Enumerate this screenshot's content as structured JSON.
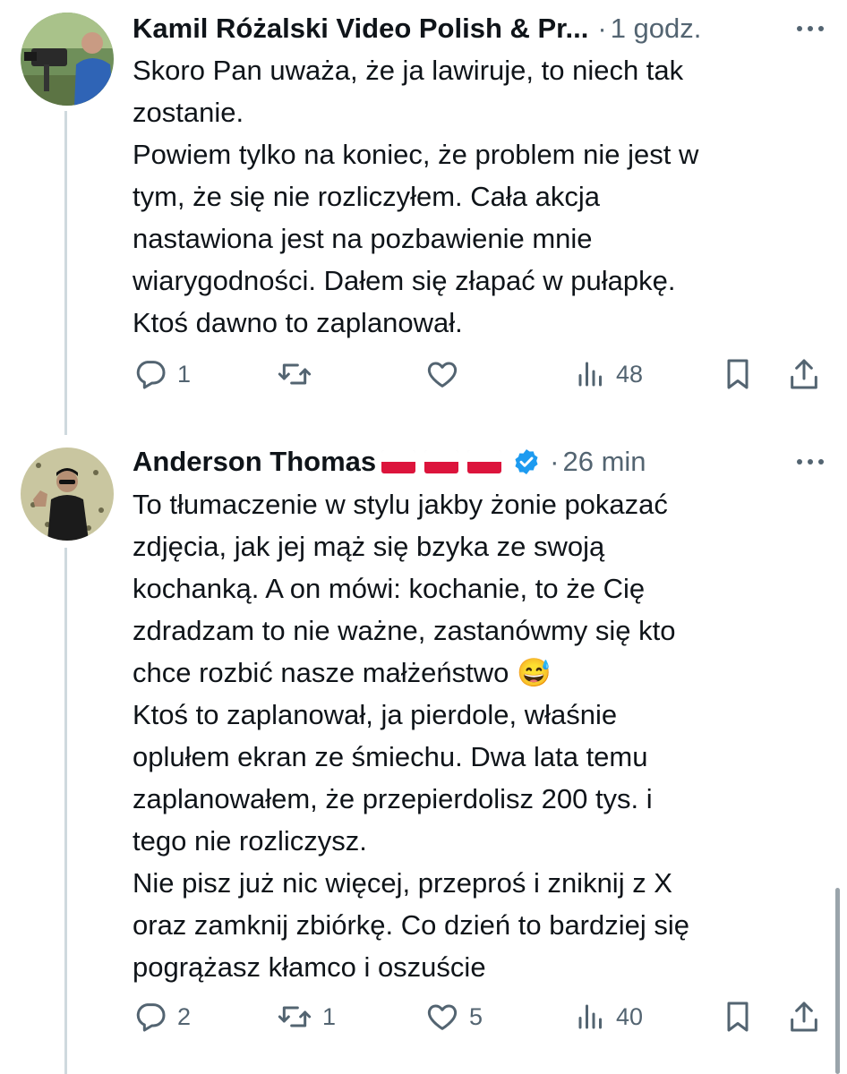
{
  "colors": {
    "text": "#0f1419",
    "secondary": "#536471",
    "verified": "#1d9bf0",
    "thread_line": "#cfd9de"
  },
  "tweets": [
    {
      "author": "Kamil Różalski Video Polish & Pr...",
      "separator": "·",
      "time": "1 godz.",
      "verified": false,
      "avatar_icon": "avatar-camera-operator",
      "lines": [
        "Skoro Pan uważa, że ja lawiruje, to niech tak",
        "zostanie.",
        "Powiem tylko na koniec, że problem nie jest w",
        "tym, że się nie rozliczyłem. Cała akcja",
        "nastawiona jest na pozbawienie mnie",
        "wiarygodności. Dałem się złapać w pułapkę.",
        "Ktoś dawno to zaplanował."
      ],
      "replies": "1",
      "reposts": "",
      "likes": "",
      "views": "48"
    },
    {
      "author": "Anderson Thomas",
      "flags_icon": "poland-flag-icon",
      "separator": "·",
      "time": "26 min",
      "verified": true,
      "avatar_icon": "avatar-matrix-neo",
      "lines": [
        "To tłumaczenie w stylu jakby żonie pokazać",
        "zdjęcia, jak jej  mąż się bzyka ze swoją",
        "kochanką. A on mówi: kochanie, to że Cię",
        "zdradzam to nie ważne, zastanówmy się kto",
        "chce rozbić nasze małżeństwo 😅",
        "Ktoś to zaplanował, ja pierdole, właśnie",
        "oplułem ekran ze śmiechu. Dwa lata temu",
        "zaplanowałem, że przepierdolisz 200 tys. i",
        "tego nie rozliczysz.",
        "Nie pisz już nic więcej, przeproś i zniknij z X",
        "oraz zamknij zbiórkę. Co dzień to bardziej się",
        "pogrążasz kłamco i oszuście"
      ],
      "replies": "2",
      "reposts": "1",
      "likes": "5",
      "views": "40"
    }
  ]
}
